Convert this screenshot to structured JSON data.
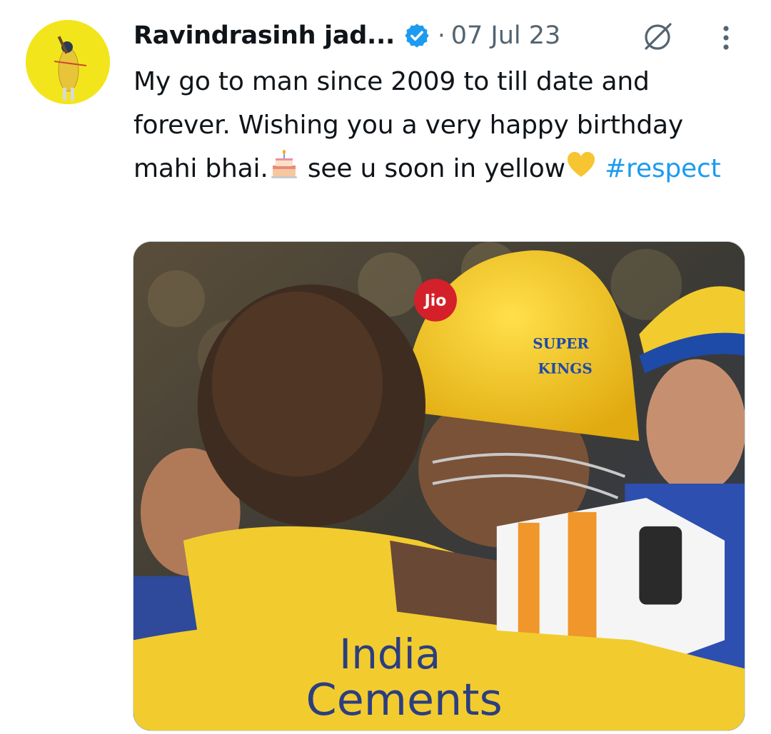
{
  "tweet": {
    "author_name": "Ravindrasinh jad...",
    "separator": "·",
    "date": "07 Jul 23",
    "text_part1": "My go to man since 2009 to till date and forever. Wishing you a very happy birthday mahi bhai.",
    "text_part2": " see u soon in yellow",
    "hashtag": "#respect",
    "emoji_1": "birthday-cake",
    "emoji_2": "yellow-heart"
  },
  "photo": {
    "helmet_logo": "Jio",
    "helmet_badge_line1": "SUPER",
    "helmet_badge_line2": "KINGS",
    "jersey_line1": "India",
    "jersey_line2": "Cements"
  },
  "colors": {
    "verified_blue": "#1d9bf0",
    "hashtag_blue": "#1d9bf0",
    "csk_yellow": "#f2cc2e",
    "muted_text": "#536471"
  }
}
